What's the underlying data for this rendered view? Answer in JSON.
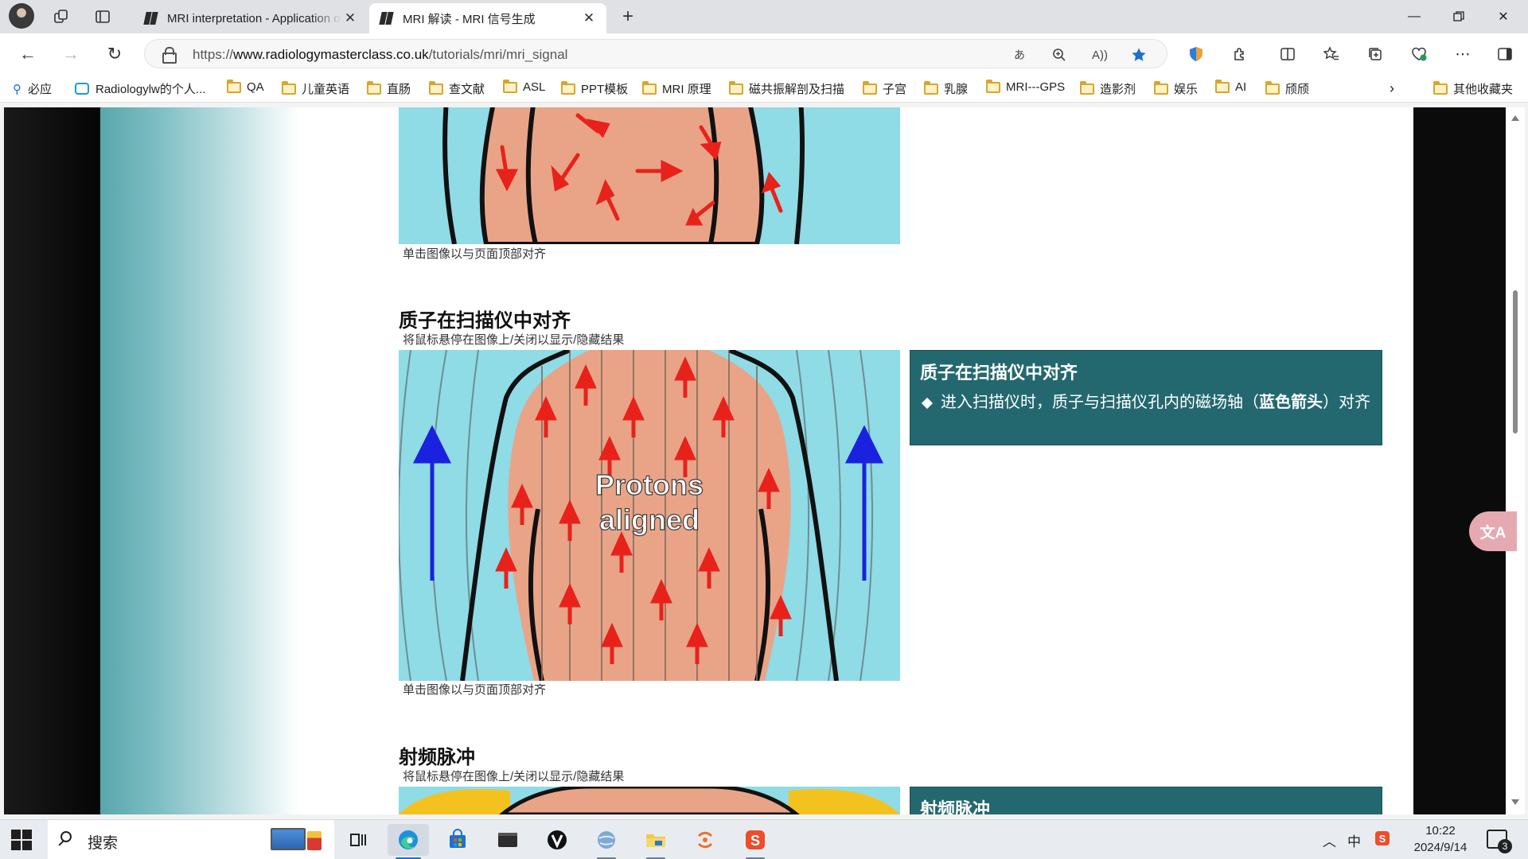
{
  "browser": {
    "tabs": [
      {
        "title": "MRI interpretation - Application of",
        "active": false
      },
      {
        "title": "MRI 解读 - MRI 信号生成",
        "active": true
      }
    ],
    "url_prefix": "https://",
    "url_domain": "www.radiologymasterclass.co.uk",
    "url_path": "/tutorials/mri/mri_signal",
    "bookmarks": [
      {
        "label": "必应",
        "icon": "bing-search-icon"
      },
      {
        "label": "Radiologylw的个人...",
        "icon": "bilibili-icon"
      },
      {
        "label": "QA",
        "icon": "folder-icon"
      },
      {
        "label": "儿童英语",
        "icon": "folder-icon"
      },
      {
        "label": "直肠",
        "icon": "folder-icon"
      },
      {
        "label": "查文献",
        "icon": "folder-icon"
      },
      {
        "label": "ASL",
        "icon": "folder-icon"
      },
      {
        "label": "PPT模板",
        "icon": "folder-icon"
      },
      {
        "label": "MRI 原理",
        "icon": "folder-icon"
      },
      {
        "label": "磁共振解剖及扫描",
        "icon": "folder-icon"
      },
      {
        "label": "子宫",
        "icon": "folder-icon"
      },
      {
        "label": "乳腺",
        "icon": "folder-icon"
      },
      {
        "label": "MRI---GPS",
        "icon": "folder-icon"
      },
      {
        "label": "造影剂",
        "icon": "folder-icon"
      },
      {
        "label": "娱乐",
        "icon": "folder-icon"
      },
      {
        "label": "AI",
        "icon": "folder-icon"
      },
      {
        "label": "颀颀",
        "icon": "folder-icon"
      }
    ],
    "other_bookmarks": "其他收藏夹",
    "accent_color": "#1a6fd1"
  },
  "page": {
    "caption": "单击图像以与页面顶部对齐",
    "hover_hint": "将鼠标悬停在图像上/关闭以显示/隐藏结果",
    "section1": {
      "title": "质子在扫描仪中对齐",
      "image_text_line1": "Protons",
      "image_text_line2": "aligned",
      "info_title": "质子在扫描仪中对齐",
      "info_bullet_part1": "进入扫描仪时，质子与扫描仪孔内的磁场轴（",
      "info_bullet_bold": "蓝色箭头",
      "info_bullet_part2": "）对齐"
    },
    "section2": {
      "title": "射频脉冲",
      "info_title": "射频脉冲"
    },
    "colors": {
      "info_box": "#24686f",
      "body": "#e7a286",
      "background_blue": "#8fdbe6",
      "proton_arrow": "#e8221b",
      "field_arrow": "#1a22e0"
    }
  },
  "translate_widget": "文A",
  "taskbar": {
    "search_placeholder": "搜索",
    "tray_ime": "中",
    "time": "10:22",
    "date": "2024/9/14",
    "notification_count": "3"
  }
}
